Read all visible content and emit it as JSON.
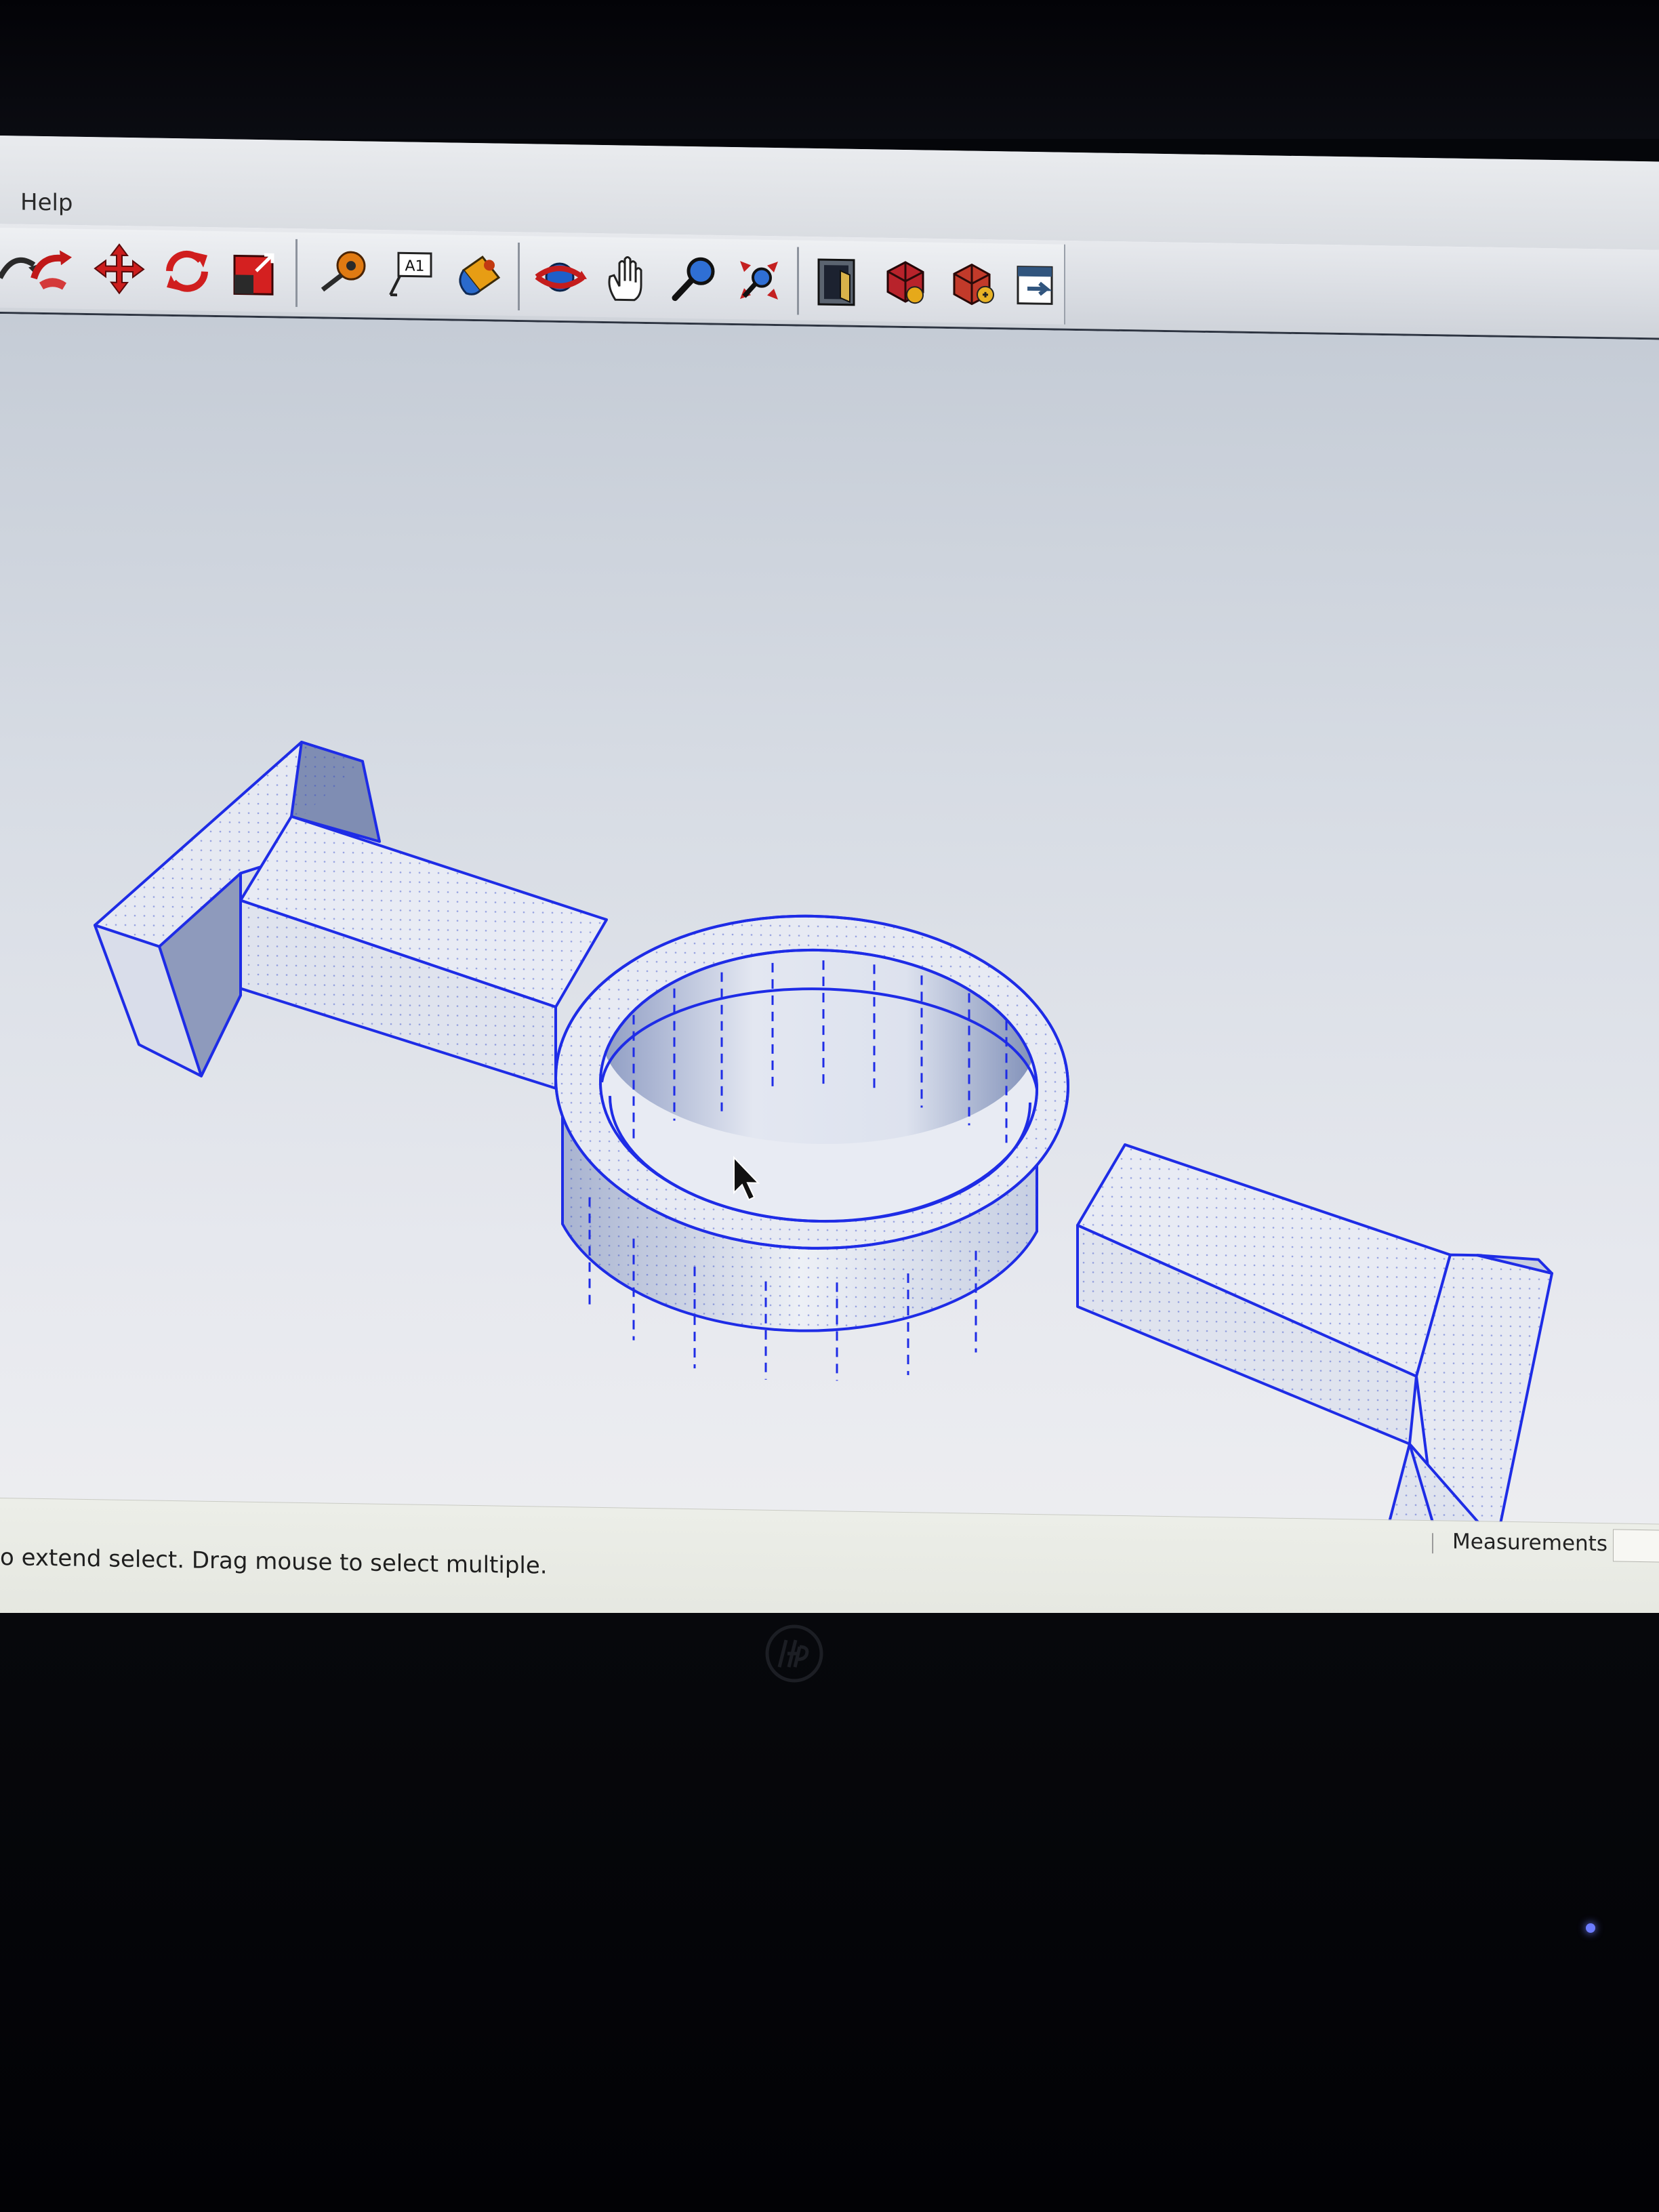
{
  "menu": {
    "help_label": "Help"
  },
  "toolbar": {
    "tools": [
      {
        "name": "orbit-partial-icon"
      },
      {
        "name": "push-pull-icon"
      },
      {
        "name": "move-icon"
      },
      {
        "name": "rotate-icon"
      },
      {
        "name": "scale-icon"
      },
      {
        "name": "tape-measure-icon"
      },
      {
        "name": "text-icon"
      },
      {
        "name": "paint-bucket-icon"
      },
      {
        "name": "orbit-icon"
      },
      {
        "name": "pan-icon"
      },
      {
        "name": "zoom-icon"
      },
      {
        "name": "zoom-extents-icon"
      },
      {
        "name": "get-models-icon"
      },
      {
        "name": "share-model-icon"
      },
      {
        "name": "share-component-icon"
      },
      {
        "name": "extension-warehouse-icon"
      }
    ],
    "text_tool_glyph": "A1"
  },
  "status": {
    "hint_text": "o extend select. Drag mouse to select multiple.",
    "measurements_label": "Measurements",
    "measurements_value": ""
  },
  "colors": {
    "edge_blue": "#1e2ce6",
    "face_light": "#e6e9f2",
    "face_shade": "#9aa6c2",
    "toolbar_bg": "#dcdfe4",
    "viewport_bg": "#d7dce4"
  }
}
